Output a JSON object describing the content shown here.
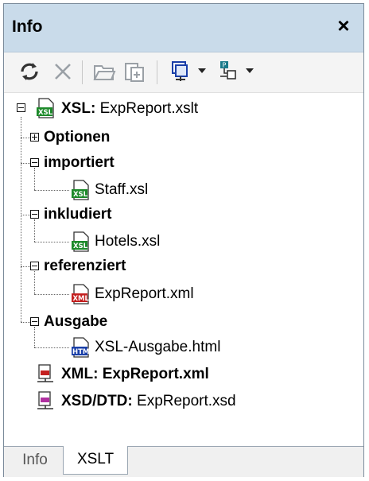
{
  "panel": {
    "title": "Info"
  },
  "toolbar": {
    "buttons": [
      {
        "name": "refresh-icon"
      },
      {
        "name": "delete-icon"
      },
      {
        "name": "open-file-icon"
      },
      {
        "name": "open-file-alt-icon"
      },
      {
        "name": "assign-icon"
      },
      {
        "name": "structure-icon"
      }
    ]
  },
  "tree": {
    "root": {
      "prefix": "XSL:",
      "file": "ExpReport.xslt",
      "icon": "xsl-file-icon"
    },
    "optionen": {
      "label": "Optionen"
    },
    "importiert": {
      "label": "importiert",
      "child": "Staff.xsl"
    },
    "inkludiert": {
      "label": "inkludiert",
      "child": "Hotels.xsl"
    },
    "referenziert": {
      "label": "referenziert",
      "child": "ExpReport.xml"
    },
    "ausgabe": {
      "label": "Ausgabe",
      "child": "XSL-Ausgabe.html"
    },
    "xml": {
      "prefix": "XML:",
      "file": "ExpReport.xml"
    },
    "xsd": {
      "prefix": "XSD/DTD:",
      "file": "ExpReport.xsd"
    }
  },
  "badges": {
    "xsl": "XSL",
    "xml": "XML",
    "htm": "HTM"
  },
  "tabs": [
    {
      "label": "Info",
      "active": false
    },
    {
      "label": "XSLT",
      "active": true
    }
  ],
  "colors": {
    "titlebar": "#c9dbea",
    "xsl": "#1d8a2a",
    "xml": "#c42020",
    "htm": "#1a3fa8",
    "xsd": "#b030a0"
  }
}
